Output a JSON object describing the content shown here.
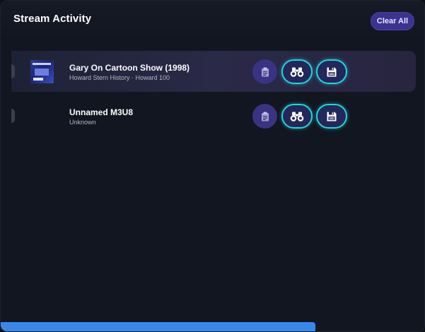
{
  "header": {
    "title": "Stream Activity",
    "clear_all_label": "Clear All"
  },
  "streams": [
    {
      "title": "Gary On Cartoon Show (1998)",
      "subtitle": "Howard Stern History · Howard 100",
      "highlighted": true,
      "has_thumbnail": true
    },
    {
      "title": "Unnamed M3U8",
      "subtitle": "Unknown",
      "highlighted": false,
      "has_thumbnail": false
    }
  ],
  "row_actions": {
    "copy_icon": "clipboard-icon",
    "watch_icon": "binoculars-icon",
    "save_icon": "floppy-disk-icon"
  },
  "progress": {
    "fraction": 0.74
  },
  "colors": {
    "accent_purple": "#3c3391",
    "accent_cyan": "#22d5dd",
    "progress_blue": "#3a87ea",
    "panel_bg": "#121620"
  }
}
